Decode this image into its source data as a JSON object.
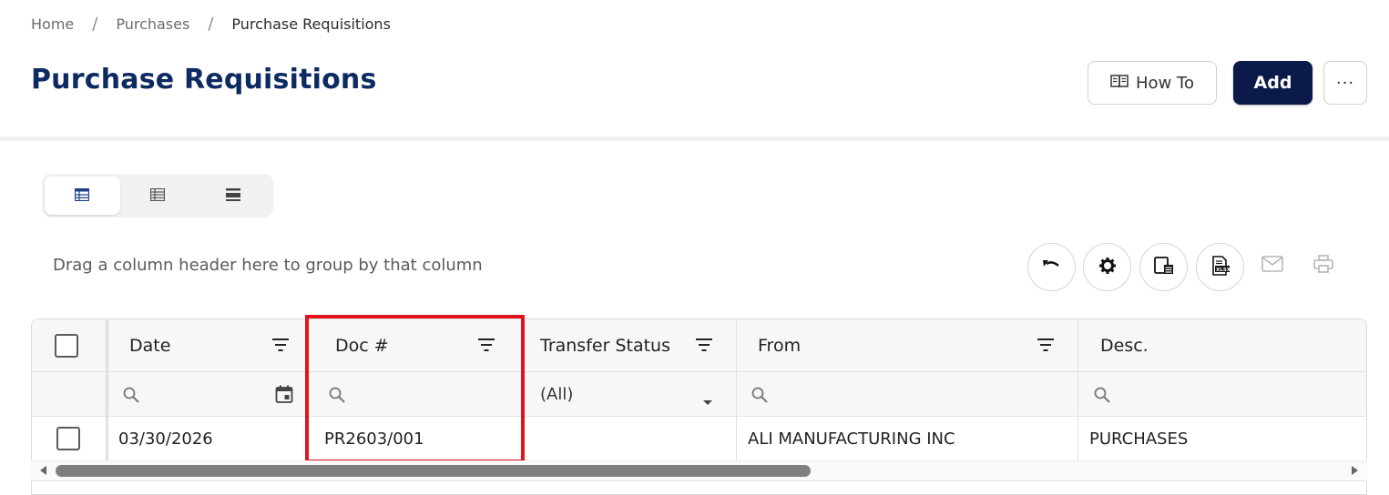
{
  "breadcrumb": {
    "items": [
      "Home",
      "Purchases",
      "Purchase Requisitions"
    ],
    "separator": "/"
  },
  "page": {
    "title": "Purchase Requisitions"
  },
  "actions": {
    "howto_label": "How To",
    "howto_icon": "book-icon",
    "add_label": "Add",
    "more_label": "···"
  },
  "view_modes": [
    {
      "icon": "grid-view-icon",
      "active": true
    },
    {
      "icon": "list-view-icon",
      "active": false
    },
    {
      "icon": "compact-view-icon",
      "active": false
    }
  ],
  "grid": {
    "group_hint": "Drag a column header here to group by that column",
    "toolbar": [
      "undo-icon",
      "gear-icon",
      "column-chooser-icon",
      "export-excel-icon",
      "mail-icon",
      "print-icon"
    ],
    "columns": [
      {
        "label": "Date"
      },
      {
        "label": "Doc #"
      },
      {
        "label": "Transfer Status"
      },
      {
        "label": "From"
      },
      {
        "label": "Desc."
      }
    ],
    "filters": {
      "transfer_status": "(All)"
    },
    "rows": [
      {
        "date": "03/30/2026",
        "doc": "PR2603/001",
        "transfer_status": "",
        "from": "ALI MANUFACTURING INC",
        "desc": "PURCHASES"
      }
    ]
  },
  "colors": {
    "title": "#0d2a61",
    "add_button": "#0b1a48",
    "link": "#28a8e0",
    "highlight": "#e0141b"
  }
}
